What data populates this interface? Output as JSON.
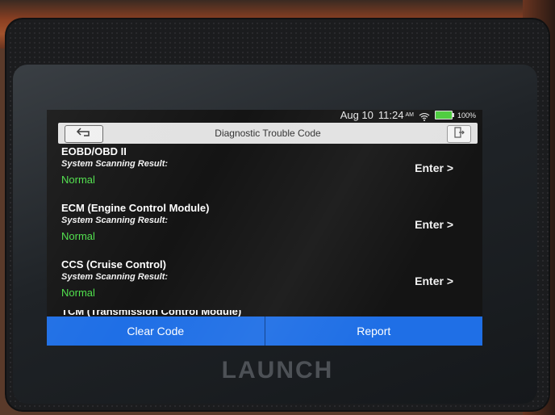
{
  "status_bar": {
    "date": "Aug 10",
    "time": "11:24",
    "ampm": "AM",
    "battery": "100%"
  },
  "title_bar": {
    "title": "Diagnostic Trouble Code"
  },
  "items": [
    {
      "name": "EOBD/OBD II",
      "label": "System Scanning Result:",
      "status": "Normal",
      "enter": "Enter >"
    },
    {
      "name": "ECM (Engine Control Module)",
      "label": "System Scanning Result:",
      "status": "Normal",
      "enter": "Enter >"
    },
    {
      "name": "CCS (Cruise Control)",
      "label": "System Scanning Result:",
      "status": "Normal",
      "enter": "Enter >"
    }
  ],
  "partial_item": {
    "name": "TCM (Transmission Control Module)"
  },
  "buttons": {
    "clear_code": "Clear Code",
    "report": "Report"
  },
  "brand": "LAUNCH",
  "colors": {
    "accent": "#1f6fe6",
    "status_normal": "#4ee04a",
    "battery": "#4ccc3c"
  },
  "icons": {
    "back": "back-arrow-icon",
    "exit": "exit-icon",
    "wifi": "wifi-icon",
    "battery": "battery-icon"
  }
}
